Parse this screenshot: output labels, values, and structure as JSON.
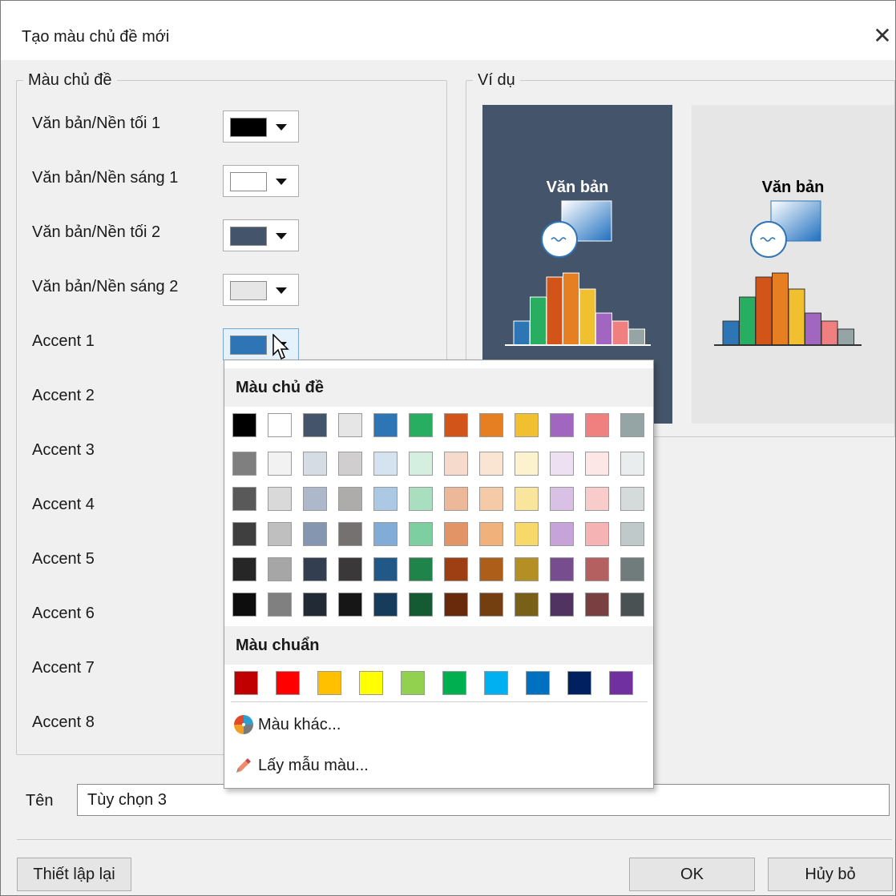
{
  "window": {
    "title": "Tạo màu chủ đề mới",
    "close_glyph": "✕"
  },
  "theme_group": {
    "legend": "Màu chủ đề",
    "rows": [
      {
        "label": "Văn bản/Nền tối 1",
        "color": "#000000"
      },
      {
        "label": "Văn bản/Nền sáng 1",
        "color": "#ffffff"
      },
      {
        "label": "Văn bản/Nền tối 2",
        "color": "#44546a"
      },
      {
        "label": "Văn bản/Nền sáng 2",
        "color": "#e7e6e6"
      },
      {
        "label": "Accent 1",
        "color": "#2e75b6"
      },
      {
        "label": "Accent 2"
      },
      {
        "label": "Accent 3"
      },
      {
        "label": "Accent 4"
      },
      {
        "label": "Accent 5"
      },
      {
        "label": "Accent 6"
      },
      {
        "label": "Accent 7"
      },
      {
        "label": "Accent 8"
      }
    ]
  },
  "example_group": {
    "legend": "Ví dụ",
    "dark_card": {
      "bg": "#44546a",
      "text": "Văn bản"
    },
    "light_card": {
      "bg": "#e7e6e6",
      "text": "Văn bản"
    },
    "histogram_colors": [
      "#2e75b6",
      "#27ae60",
      "#d35419",
      "#e67e22",
      "#f0c030",
      "#a066c0",
      "#f08080",
      "#95a5a6"
    ]
  },
  "color_popup": {
    "theme_header": "Màu chủ đề",
    "theme_rows": [
      [
        "#000000",
        "#ffffff",
        "#44546a",
        "#e7e6e6",
        "#2e75b6",
        "#27ae60",
        "#d35419",
        "#e67e22",
        "#f0c030",
        "#a066c0",
        "#f08080",
        "#95a5a6"
      ],
      [
        "#7f7f7f",
        "#f2f2f2",
        "#d6dce4",
        "#d0cece",
        "#d5e3f1",
        "#d4efdf",
        "#f6dbcc",
        "#fae5d3",
        "#fcf2cd",
        "#ece0f2",
        "#fce6e6",
        "#eaeded"
      ],
      [
        "#595959",
        "#d9d9d9",
        "#adb9ca",
        "#aeabab",
        "#abc8e4",
        "#a9dfbf",
        "#edb79a",
        "#f5cba7",
        "#f9e59b",
        "#d9c1e6",
        "#f9cccc",
        "#d5dbdb"
      ],
      [
        "#3f3f3f",
        "#bfbfbf",
        "#8496b0",
        "#757171",
        "#82acd7",
        "#7dcea0",
        "#e39467",
        "#f0b27a",
        "#f6d969",
        "#c6a3d9",
        "#f6b3b3",
        "#bfc9ca"
      ],
      [
        "#262626",
        "#a6a6a6",
        "#333f50",
        "#3a3838",
        "#225888",
        "#1e8449",
        "#9e3f13",
        "#ad5f1a",
        "#b49024",
        "#784d90",
        "#b46060",
        "#707b7c"
      ],
      [
        "#0d0d0d",
        "#808080",
        "#222a35",
        "#171616",
        "#173b5b",
        "#145a32",
        "#692a0c",
        "#733f11",
        "#786018",
        "#503360",
        "#784040",
        "#4a5152"
      ]
    ],
    "standard_header": "Màu chuẩn",
    "standard_colors": [
      "#c00000",
      "#ff0000",
      "#ffc000",
      "#ffff00",
      "#92d050",
      "#00b050",
      "#00b0f0",
      "#0070c0",
      "#002060",
      "#7030a0"
    ],
    "more_colors_label": "Màu khác...",
    "eyedropper_label": "Lấy mẫu màu..."
  },
  "name_field": {
    "label": "Tên",
    "value": "Tùy chọn 3"
  },
  "buttons": {
    "reset": "Thiết lập lại",
    "ok": "OK",
    "cancel": "Hủy bỏ"
  }
}
